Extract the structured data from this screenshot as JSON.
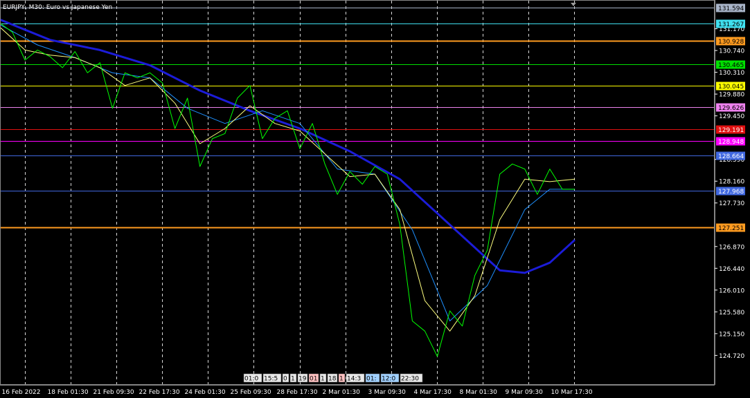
{
  "window": {
    "title": "EURJPY, M30:  Euro vs Japanese Yen"
  },
  "colors": {
    "background": "#000000",
    "grid": "#ffffff",
    "price_line": "#00ff00",
    "ma_fast": "#ffff80",
    "ma_mid": "#1e90ff",
    "ma_slow": "#1c1cd8"
  },
  "chart_data": {
    "type": "line",
    "title": "EURJPY, M30:  Euro vs Japanese Yen",
    "xlabel": "",
    "ylabel": "",
    "ylim": [
      124.5,
      131.75
    ],
    "grid": "vertical dashed",
    "x_ticks": [
      "16 Feb 2022",
      "18 Feb 01:30",
      "21 Feb 09:30",
      "22 Feb 17:30",
      "24 Feb 01:30",
      "25 Feb 09:30",
      "28 Feb 17:30",
      "2 Mar 01:30",
      "3 Mar 09:30",
      "4 Mar 17:30",
      "8 Mar 01:30",
      "9 Mar 09:30",
      "10 Mar 17:30"
    ],
    "y_ticks": [
      "131.170",
      "130.740",
      "130.310",
      "129.880",
      "129.450",
      "128.590",
      "128.160",
      "127.730",
      "126.870",
      "126.440",
      "126.010",
      "125.580",
      "125.150",
      "124.720"
    ],
    "price_levels": [
      {
        "label": "131.594",
        "value": 131.594,
        "color": "#a8b4c8"
      },
      {
        "label": "131.267",
        "value": 131.267,
        "color": "#40e0f0"
      },
      {
        "label": "130.928",
        "value": 130.928,
        "color": "#ff9b20"
      },
      {
        "label": "130.465",
        "value": 130.465,
        "color": "#00e000"
      },
      {
        "label": "130.045",
        "value": 130.045,
        "color": "#ffff00"
      },
      {
        "label": "129.626",
        "value": 129.626,
        "color": "#ee82ee"
      },
      {
        "label": "129.191",
        "value": 129.191,
        "color": "#e01010"
      },
      {
        "label": "128.948",
        "value": 128.948,
        "color": "#ff00ff"
      },
      {
        "label": "128.664",
        "value": 128.664,
        "color": "#4169e1"
      },
      {
        "label": "127.968",
        "value": 127.968,
        "color": "#4169e1"
      },
      {
        "label": "127.251",
        "value": 127.251,
        "color": "#ff9b20"
      }
    ],
    "overlay_time_labels": [
      "01:0",
      "15:5",
      "0",
      "1",
      "19",
      "01",
      "1",
      "18",
      "1",
      "14:3",
      "01:",
      "12:0",
      "22:30"
    ],
    "series": [
      {
        "name": "",
        "values": [
          [
            0,
            131.28
          ],
          [
            1,
            131.1
          ],
          [
            2,
            130.55
          ],
          [
            3,
            130.75
          ],
          [
            4,
            130.62
          ],
          [
            5,
            130.4
          ],
          [
            6,
            130.72
          ],
          [
            7,
            130.3
          ],
          [
            8,
            130.5
          ],
          [
            9,
            129.6
          ],
          [
            10,
            130.3
          ],
          [
            11,
            130.2
          ],
          [
            12,
            130.3
          ],
          [
            13,
            130.1
          ],
          [
            14,
            129.2
          ],
          [
            15,
            129.8
          ],
          [
            16,
            128.45
          ],
          [
            17,
            129.0
          ],
          [
            18,
            129.1
          ],
          [
            19,
            129.8
          ],
          [
            20,
            130.05
          ],
          [
            21,
            129.0
          ],
          [
            22,
            129.4
          ],
          [
            23,
            129.55
          ],
          [
            24,
            128.8
          ],
          [
            25,
            129.3
          ],
          [
            26,
            128.5
          ],
          [
            27,
            127.9
          ],
          [
            28,
            128.35
          ],
          [
            29,
            128.1
          ],
          [
            30,
            128.45
          ],
          [
            31,
            128.3
          ],
          [
            32,
            127.3
          ],
          [
            33,
            125.4
          ],
          [
            34,
            125.2
          ],
          [
            35,
            124.7
          ],
          [
            36,
            125.6
          ],
          [
            37,
            125.3
          ],
          [
            38,
            126.3
          ],
          [
            39,
            126.8
          ],
          [
            40,
            128.3
          ],
          [
            41,
            128.5
          ],
          [
            42,
            128.4
          ],
          [
            43,
            127.9
          ],
          [
            44,
            128.4
          ],
          [
            45,
            128.0
          ],
          [
            46,
            128.0
          ]
        ]
      },
      {
        "name": "",
        "values": [
          [
            0,
            131.2
          ],
          [
            2,
            130.75
          ],
          [
            4,
            130.65
          ],
          [
            6,
            130.6
          ],
          [
            8,
            130.4
          ],
          [
            10,
            130.05
          ],
          [
            12,
            130.2
          ],
          [
            14,
            129.7
          ],
          [
            16,
            128.9
          ],
          [
            18,
            129.2
          ],
          [
            20,
            129.65
          ],
          [
            22,
            129.3
          ],
          [
            24,
            129.15
          ],
          [
            26,
            128.7
          ],
          [
            28,
            128.25
          ],
          [
            30,
            128.3
          ],
          [
            32,
            127.6
          ],
          [
            34,
            125.8
          ],
          [
            36,
            125.2
          ],
          [
            38,
            125.9
          ],
          [
            40,
            127.4
          ],
          [
            42,
            128.2
          ],
          [
            44,
            128.15
          ],
          [
            46,
            128.2
          ]
        ]
      },
      {
        "name": "",
        "values": [
          [
            0,
            131.25
          ],
          [
            3,
            130.85
          ],
          [
            6,
            130.6
          ],
          [
            9,
            130.3
          ],
          [
            12,
            130.2
          ],
          [
            15,
            129.6
          ],
          [
            18,
            129.3
          ],
          [
            21,
            129.55
          ],
          [
            24,
            129.3
          ],
          [
            27,
            128.4
          ],
          [
            30,
            128.3
          ],
          [
            33,
            127.2
          ],
          [
            36,
            125.4
          ],
          [
            39,
            126.1
          ],
          [
            42,
            127.6
          ],
          [
            44,
            128.0
          ],
          [
            46,
            128.0
          ]
        ]
      },
      {
        "name": "",
        "values": [
          [
            0,
            131.35
          ],
          [
            4,
            130.95
          ],
          [
            8,
            130.75
          ],
          [
            12,
            130.45
          ],
          [
            16,
            129.95
          ],
          [
            20,
            129.55
          ],
          [
            24,
            129.2
          ],
          [
            28,
            128.75
          ],
          [
            32,
            128.2
          ],
          [
            36,
            127.3
          ],
          [
            40,
            126.4
          ],
          [
            42,
            126.35
          ],
          [
            44,
            126.55
          ],
          [
            46,
            127.0
          ]
        ]
      }
    ]
  }
}
